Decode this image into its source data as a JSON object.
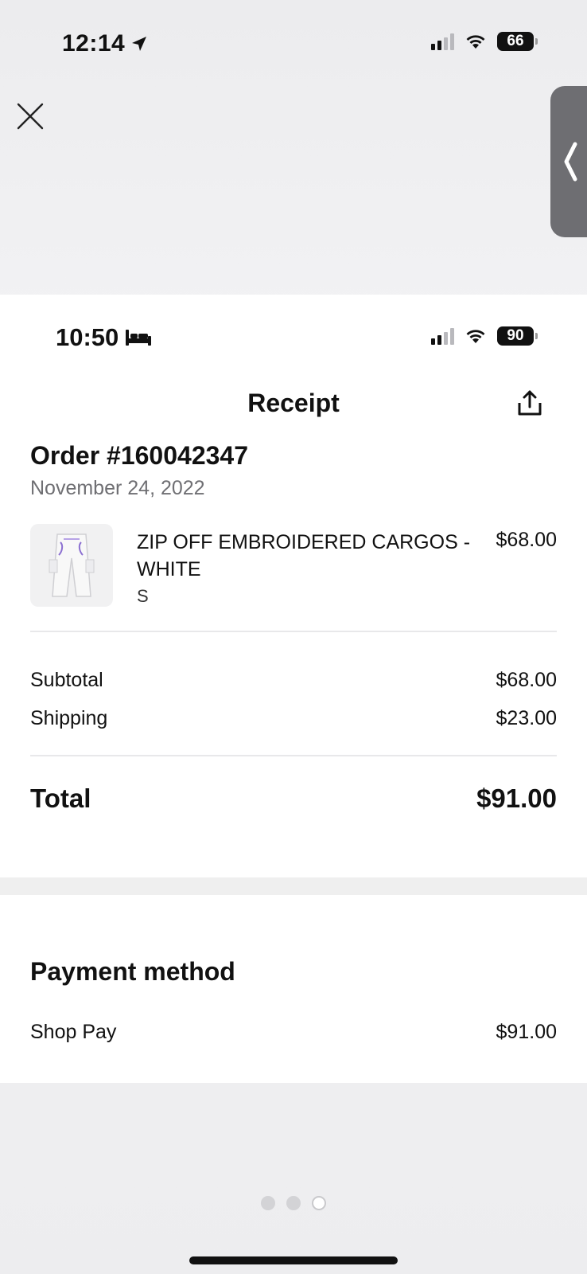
{
  "outer_status": {
    "time": "12:14",
    "battery": "66",
    "battery_color": "#111111"
  },
  "viewer": {
    "close_icon": "close-icon",
    "side_tab_icon": "chevron-left-icon"
  },
  "inner_status": {
    "time": "10:50",
    "battery": "90",
    "battery_color": "#111111"
  },
  "receipt": {
    "title": "Receipt",
    "order_number": "Order #160042347",
    "date": "November 24, 2022",
    "item": {
      "name": "ZIP OFF EMBROIDERED CARGOS - WHITE",
      "variant": "S",
      "price": "$68.00"
    },
    "subtotal_label": "Subtotal",
    "subtotal_value": "$68.00",
    "shipping_label": "Shipping",
    "shipping_value": "$23.00",
    "total_label": "Total",
    "total_value": "$91.00"
  },
  "payment": {
    "heading": "Payment method",
    "method": "Shop Pay",
    "amount": "$91.00"
  },
  "pager": {
    "count": 3,
    "active_index": 2
  }
}
